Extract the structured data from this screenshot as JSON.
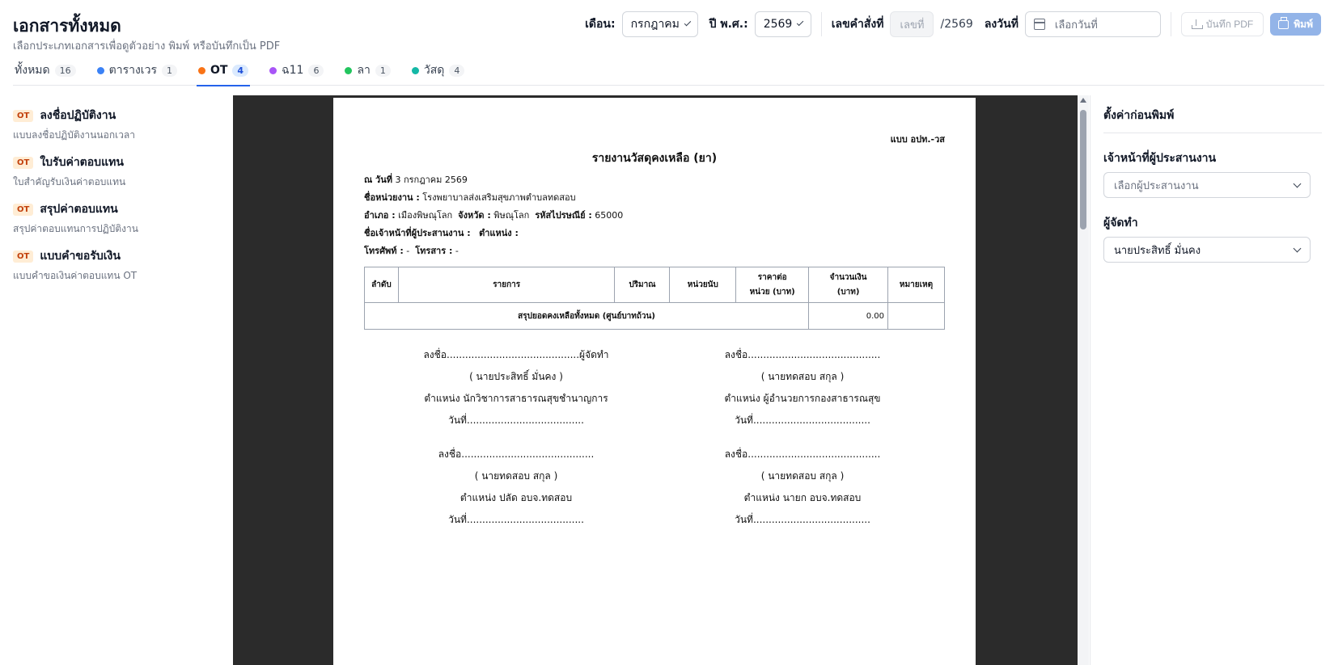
{
  "header": {
    "title": "เอกสารทั้งหมด",
    "subtitle": "เลือกประเภทเอกสารเพื่อดูตัวอย่าง พิมพ์ หรือบันทึกเป็น PDF",
    "month_label": "เดือน:",
    "month_value": "กรกฎาคม",
    "year_label": "ปี พ.ศ.:",
    "year_value": "2569",
    "order_label": "เลขคำสั่งที่",
    "order_placeholder": "เลขที่",
    "order_suffix": "/2569",
    "date_label": "ลงวันที่",
    "date_placeholder": "เลือกวันที่",
    "pdf_label": "บันทึก PDF",
    "print_label": "พิมพ์"
  },
  "tabs": [
    {
      "label": "ทั้งหมด",
      "count": "16",
      "color": ""
    },
    {
      "label": "ตารางเวร",
      "count": "1",
      "color": "#3b82f6"
    },
    {
      "label": "OT",
      "count": "4",
      "color": "#f97316"
    },
    {
      "label": "ฉ11",
      "count": "6",
      "color": "#a855f7"
    },
    {
      "label": "ลา",
      "count": "1",
      "color": "#22c55e"
    },
    {
      "label": "วัสดุ",
      "count": "4",
      "color": "#14b8a6"
    }
  ],
  "sidebar": {
    "items": [
      {
        "badge": "OT",
        "title": "ลงชื่อปฏิบัติงาน",
        "desc": "แบบลงชื่อปฏิบัติงานนอกเวลา"
      },
      {
        "badge": "OT",
        "title": "ใบรับค่าตอบแทน",
        "desc": "ใบสำคัญรับเงินค่าตอบแทน"
      },
      {
        "badge": "OT",
        "title": "สรุปค่าตอบแทน",
        "desc": "สรุปค่าตอบแทนการปฏิบัติงาน"
      },
      {
        "badge": "OT",
        "title": "แบบคำขอรับเงิน",
        "desc": "แบบคำขอเงินค่าตอบแทน OT"
      }
    ]
  },
  "document": {
    "form_code": "แบบ อปท.-วส",
    "title": "รายงานวัสดุคงเหลือ (ยา)",
    "date_label": "ณ วันที่",
    "date_value": "3 กรกฎาคม 2569",
    "unit_label": "ชื่อหน่วยงาน :",
    "unit_value": "โรงพยาบาลส่งเสริมสุขภาพตำบลทดสอบ",
    "district_label": "อำเภอ :",
    "district_value": "เมืองพิษณุโลก",
    "province_label": "จังหวัด :",
    "province_value": "พิษณุโลก",
    "postal_label": "รหัสไปรษณีย์ :",
    "postal_value": "65000",
    "coordinator_label": "ชื่อเจ้าหน้าที่ผู้ประสานงาน :",
    "position_label": "ตำแหน่ง :",
    "phone_label": "โทรศัพท์ :",
    "phone_value": "-",
    "fax_label": "โทรสาร :",
    "fax_value": "-",
    "table": {
      "col_no": "ลำดับ",
      "col_item": "รายการ",
      "col_qty": "ปริมาณ",
      "col_unit": "หน่วยนับ",
      "col_price_1": "ราคาต่อ",
      "col_price_2": "หน่วย (บาท)",
      "col_amount_1": "จำนวนเงิน",
      "col_amount_2": "(บาท)",
      "col_note": "หมายเหตุ",
      "total_label": "สรุปยอดคงเหลือทั้งหมด (ศูนย์บาทถ้วน)",
      "total_value": "0.00"
    },
    "signatures": [
      {
        "sign": "ลงชื่อ...........................................ผู้จัดทำ",
        "name": "( นายประสิทธิ์ มั่นคง )",
        "position": "ตำแหน่ง นักวิชาการสาธารณสุขชำนาญการ",
        "date": "วันที่......................................"
      },
      {
        "sign": "ลงชื่อ...........................................",
        "name": "( นายทดสอบ สกุล )",
        "position": "ตำแหน่ง ผู้อำนวยการกองสาธารณสุข",
        "date": "วันที่......................................"
      },
      {
        "sign": "ลงชื่อ...........................................",
        "name": "( นายทดสอบ สกุล )",
        "position": "ตำแหน่ง ปลัด อบจ.ทดสอบ",
        "date": "วันที่......................................"
      },
      {
        "sign": "ลงชื่อ...........................................",
        "name": "( นายทดสอบ สกุล )",
        "position": "ตำแหน่ง นายก อบจ.ทดสอบ",
        "date": "วันที่......................................"
      }
    ]
  },
  "settings": {
    "title": "ตั้งค่าก่อนพิมพ์",
    "coordinator_label": "เจ้าหน้าที่ผู้ประสานงาน",
    "coordinator_placeholder": "เลือกผู้ประสานงาน",
    "preparer_label": "ผู้จัดทำ",
    "preparer_value": "นายประสิทธิ์ มั่นคง"
  }
}
